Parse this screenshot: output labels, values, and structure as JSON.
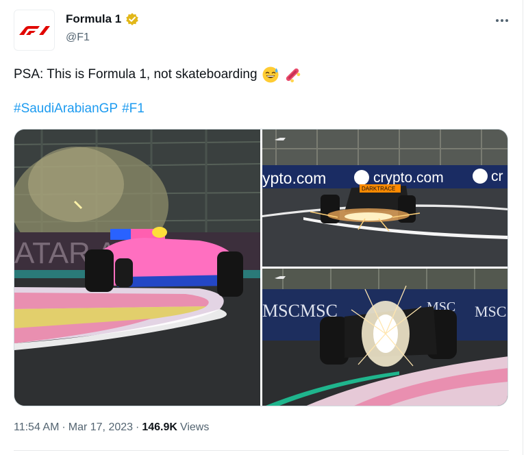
{
  "author": {
    "display_name": "Formula 1",
    "handle": "@F1",
    "avatar_icon": "f1-logo-icon",
    "verified_icon": "verified-badge-icon",
    "verified_color": "#e2b719"
  },
  "more_icon": "more-dots-icon",
  "tweet": {
    "text": "PSA: This is Formula 1, not skateboarding",
    "emojis": [
      "grinning-sweat-emoji",
      "skateboard-emoji"
    ],
    "hashtags": [
      "#SaudiArabianGP",
      "#F1"
    ]
  },
  "media": {
    "photos": [
      {
        "name": "photo-alpine-car-dust",
        "signage": "ATAR  AYS"
      },
      {
        "name": "photo-mclaren-sparks",
        "signage_a": "ypto.com",
        "signage_b": "crypto.com",
        "signage_c": "cr",
        "rear_text": "DARKTRACE"
      },
      {
        "name": "photo-car-sparks-rear",
        "signage": "MSC"
      }
    ]
  },
  "meta": {
    "time": "11:54 AM",
    "date": "Mar 17, 2023",
    "views_count": "146.9K",
    "views_label": "Views",
    "separator": "·"
  },
  "colors": {
    "link": "#1d9bf0",
    "text": "#0f1419",
    "secondary": "#536471",
    "f1_red": "#e10600"
  }
}
